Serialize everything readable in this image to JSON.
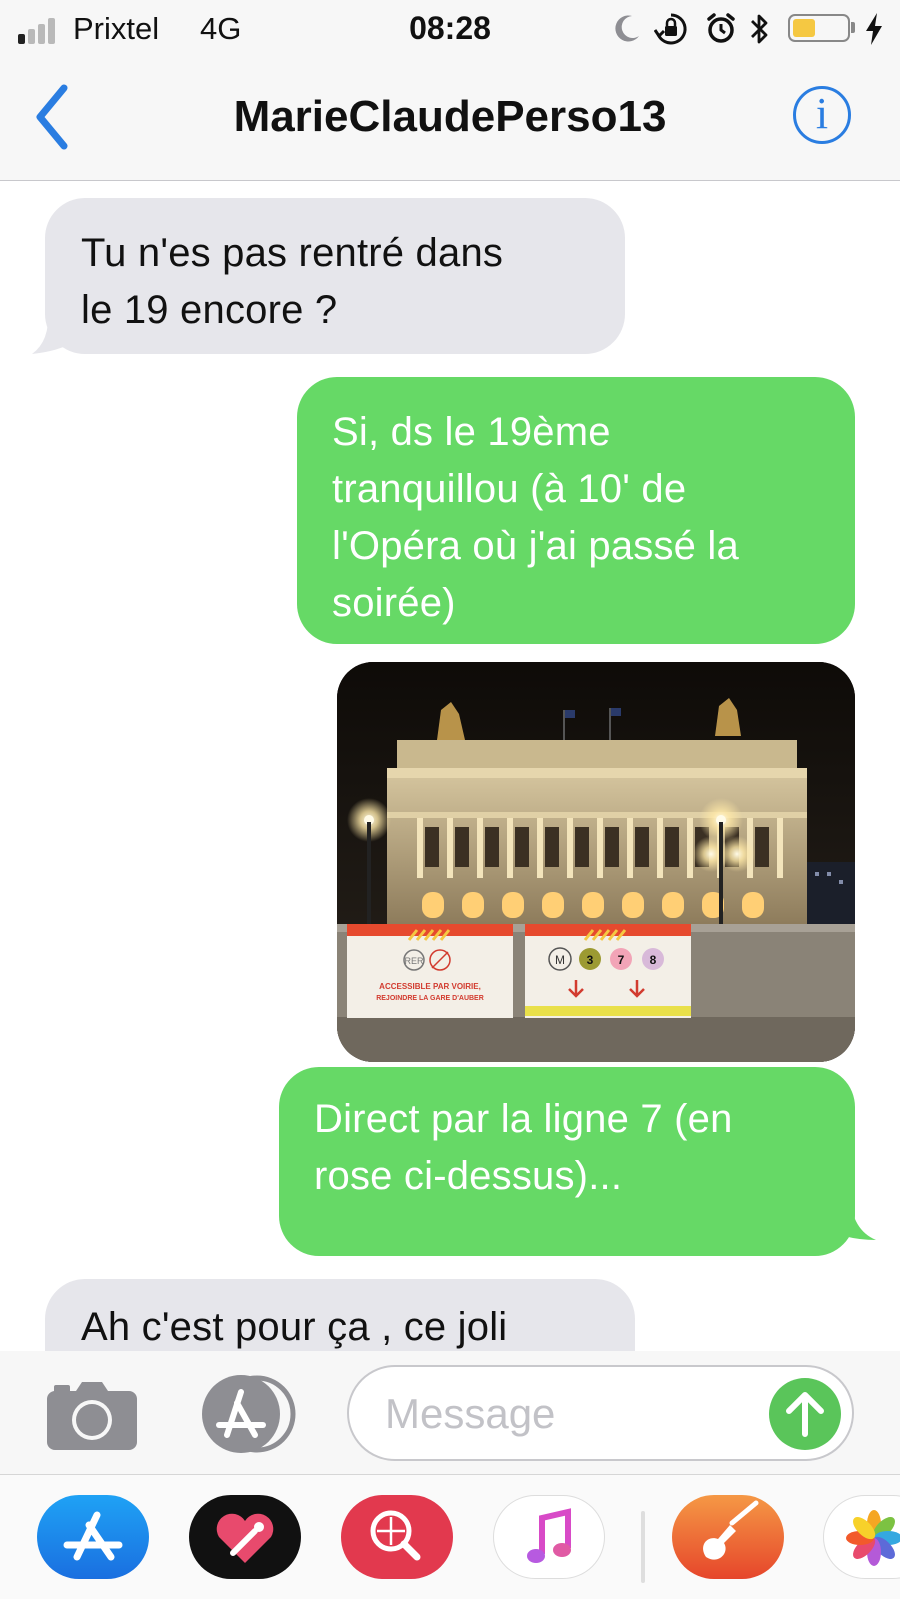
{
  "status_bar": {
    "carrier": "Prixtel",
    "network": "4G",
    "time": "08:28",
    "signal_bars_active": 1,
    "icons": [
      "moon-icon",
      "orientation-lock-icon",
      "alarm-icon",
      "bluetooth-icon",
      "battery-icon",
      "charging-icon"
    ],
    "battery_level": 0.4,
    "battery_color": "#f5c842"
  },
  "nav": {
    "contact_name": "MarieClaudePerso13",
    "info_symbol": "i",
    "accent_color": "#2a7de1"
  },
  "messages": [
    {
      "from": "them",
      "text_lines": [
        "Tu n'es pas rentré dans",
        "le 19 encore ?"
      ]
    },
    {
      "from": "me",
      "text_lines": [
        "Si, ds le 19ème",
        "tranquillou (à 10' de",
        "l'Opéra où j'ai passé la",
        "soirée)"
      ]
    },
    {
      "from": "me",
      "type": "photo"
    },
    {
      "from": "me",
      "text_lines": [
        "Direct par la ligne 7 (en",
        "rose ci-dessus)..."
      ]
    },
    {
      "from": "them",
      "text_lines": [
        "Ah c'est pour ça , ce joli"
      ]
    }
  ],
  "photo": {
    "sign_left_text": [
      "ACCESSIBLE PAR VOIRIE,",
      "REJOINDRE LA GARE D'AUBER"
    ],
    "sign_left_badge": "RER",
    "sign_right_lines": [
      "M",
      "3",
      "7",
      "8"
    ]
  },
  "input": {
    "placeholder": "Message"
  },
  "colors": {
    "sent_bubble": "#66d966",
    "received_bubble": "#e6e6eb",
    "send_button": "#5ac55a"
  },
  "app_drawer": {
    "apps": [
      "app-store-icon",
      "digital-touch-icon",
      "web-images-icon",
      "music-icon",
      "garageband-icon",
      "photos-icon"
    ]
  }
}
